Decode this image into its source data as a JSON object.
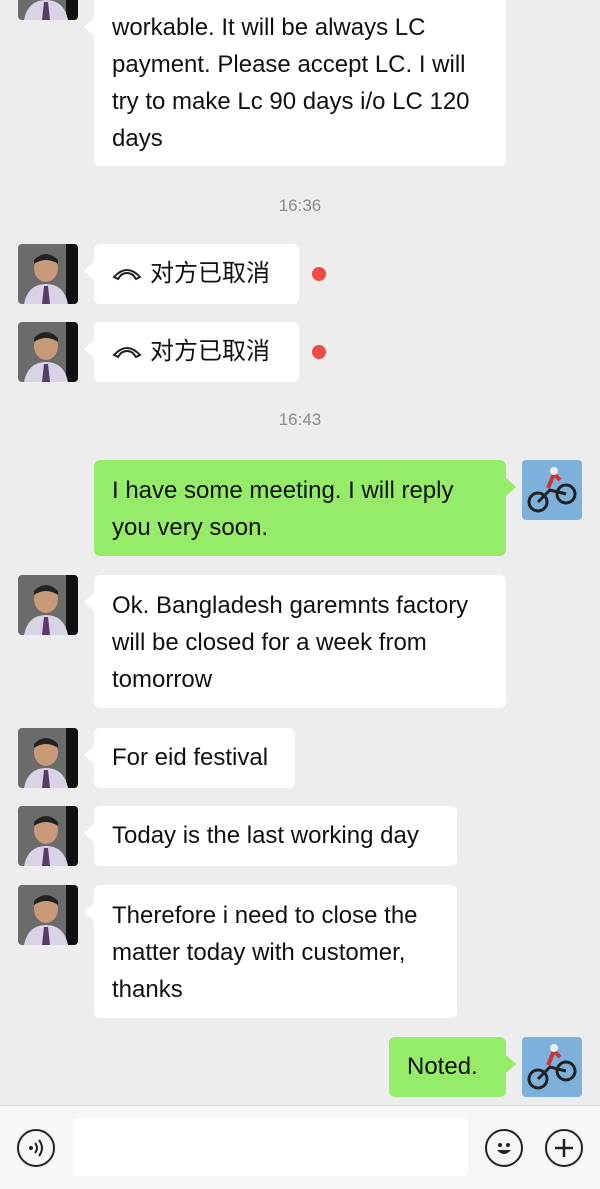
{
  "messages": {
    "m1_text": "workable. It will be always LC payment. Please accept LC. I will try to make Lc 90 days i/o LC 120 days",
    "time1": "16:36",
    "call1_text": "对方已取消",
    "call2_text": "对方已取消",
    "time2": "16:43",
    "m2_text": "I have some meeting. I will reply you very soon.",
    "m3_text": "Ok. Bangladesh garemnts factory will be closed for a week from tomorrow",
    "m4_text": "For eid festival",
    "m5_text": "Today is the last working day",
    "m6_text": "Therefore i need to close the matter today with customer, thanks",
    "m7_text": "Noted."
  },
  "icons": {
    "call": "hang-up-phone-icon",
    "unread": "red-dot-icon",
    "voice": "voice-icon",
    "emoji": "smiley-icon",
    "add": "plus-icon"
  },
  "colors": {
    "incoming_bubble": "#ffffff",
    "outgoing_bubble": "#95ec69",
    "background": "#ededed",
    "unread_dot": "#f04a45"
  }
}
